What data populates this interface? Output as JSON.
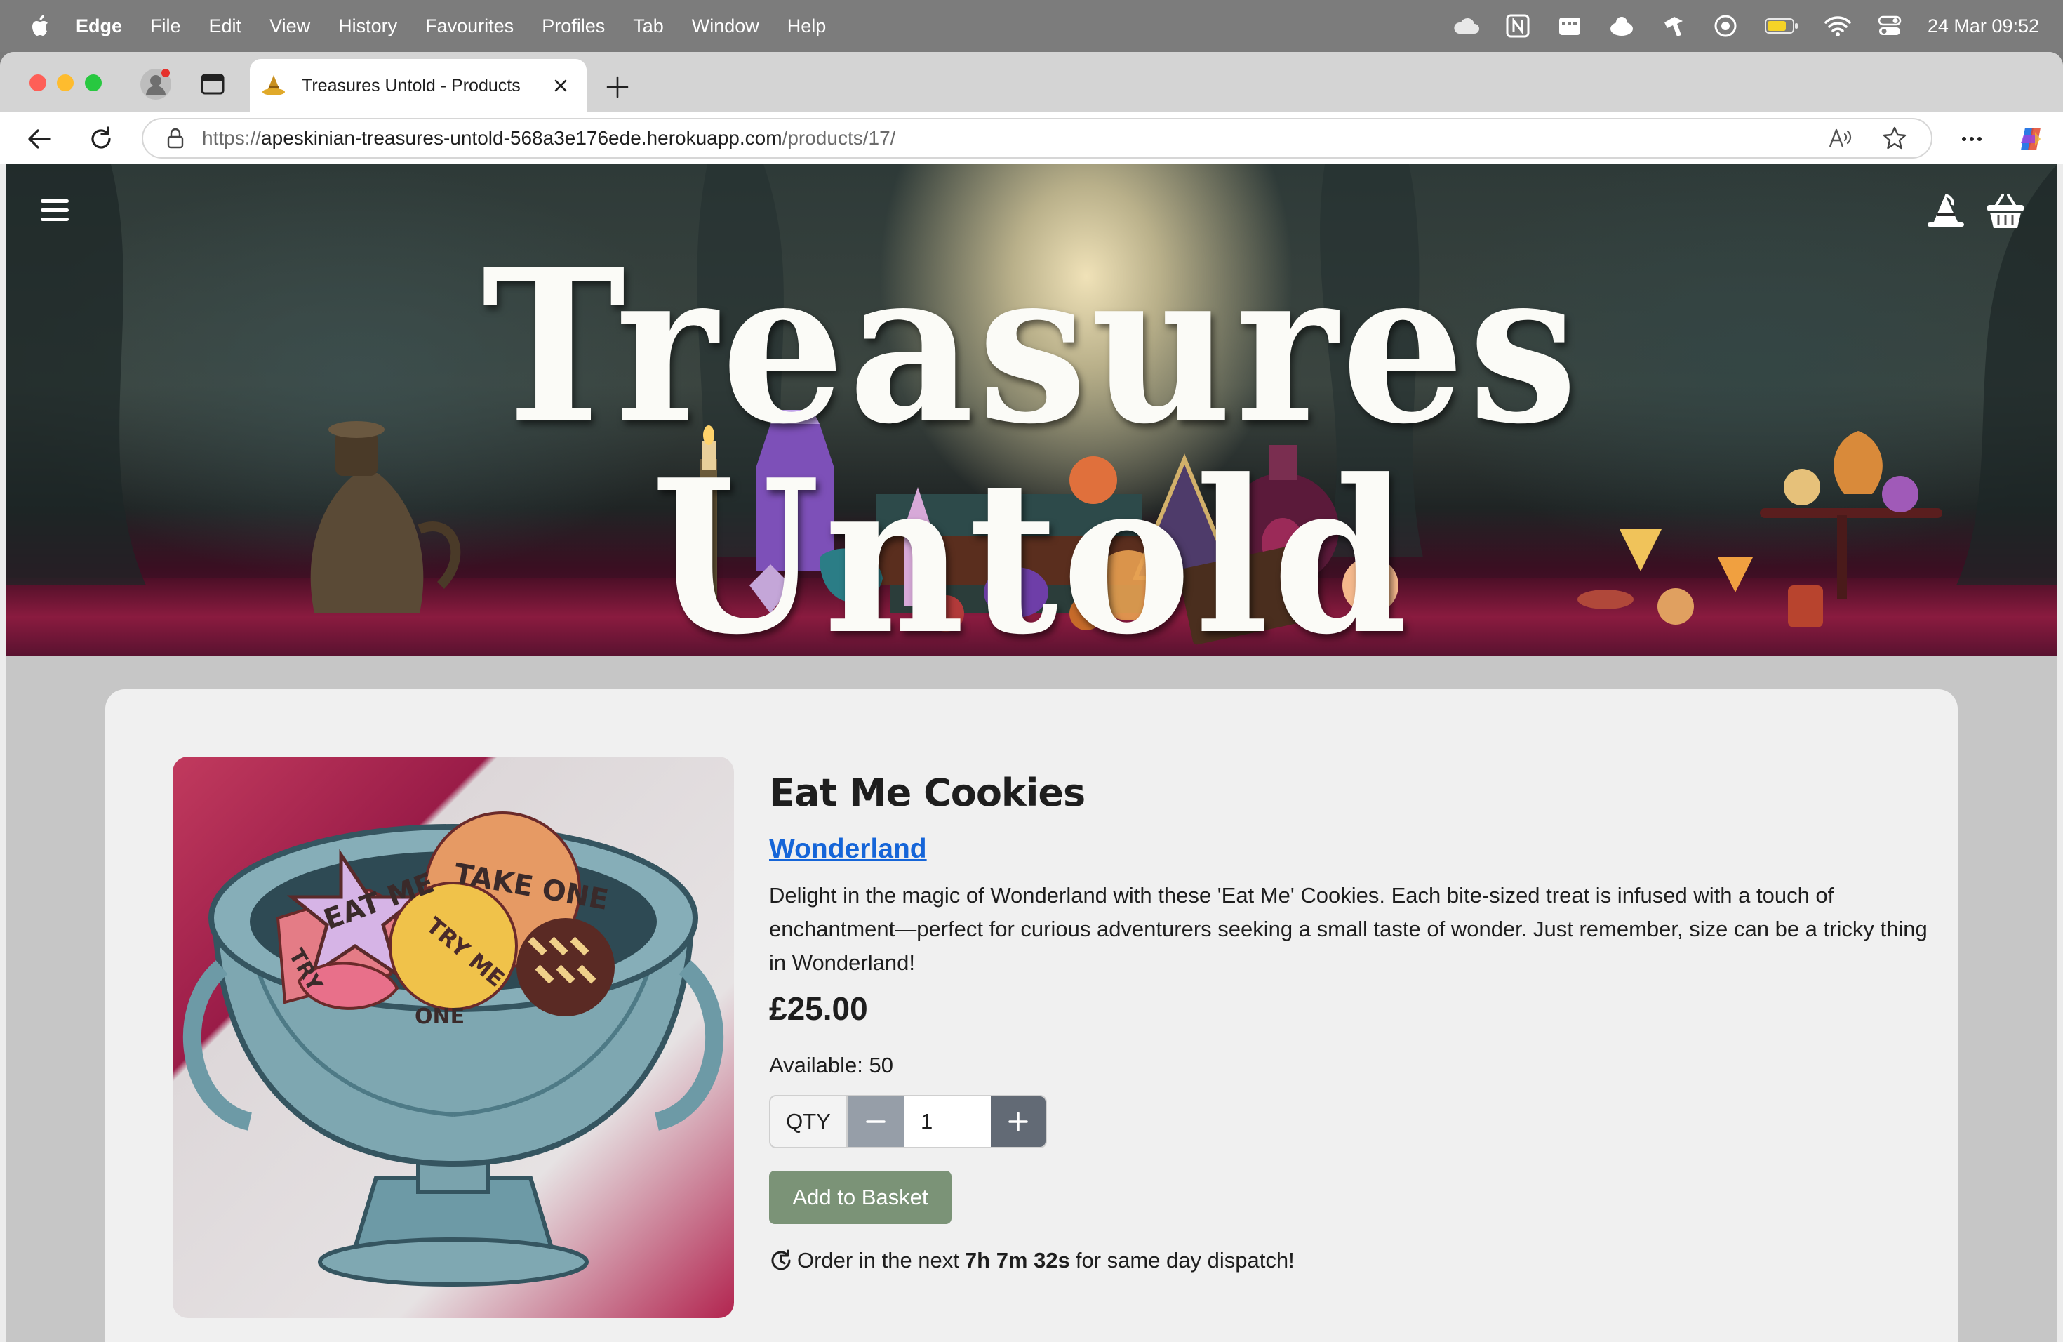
{
  "menubar": {
    "app_name": "Edge",
    "items": [
      "File",
      "Edit",
      "View",
      "History",
      "Favourites",
      "Profiles",
      "Tab",
      "Window",
      "Help"
    ],
    "clock": "24 Mar  09:52"
  },
  "browser": {
    "tab_title": "Treasures Untold - Products",
    "url_scheme": "https://",
    "url_host": "apeskinian-treasures-untold-568a3e176ede.herokuapp.com",
    "url_path": "/products/17/"
  },
  "site": {
    "title": "Treasures Untold"
  },
  "product": {
    "name": "Eat Me Cookies",
    "category": "Wonderland",
    "description": "Delight in the magic of Wonderland with these 'Eat Me' Cookies. Each bite-sized treat is infused with a touch of enchantment—perfect for curious adventurers seeking a small taste of wonder. Just remember, size can be a tricky thing in Wonderland!",
    "price": "£25.00",
    "availability": "Available: 50",
    "qty_label": "QTY",
    "qty_value": "1",
    "add_button": "Add to Basket",
    "dispatch_prefix": "Order in the next",
    "dispatch_countdown": "7h 7m 32s",
    "dispatch_suffix": "for same day dispatch!",
    "image_text": [
      "EAT ME",
      "TAKE ONE",
      "TRY ME",
      "TRY",
      "ONE"
    ]
  },
  "colors": {
    "accent_link": "#1565d8",
    "add_button": "#7b9377",
    "qty_minus": "#969ea8",
    "qty_plus": "#626a75"
  }
}
